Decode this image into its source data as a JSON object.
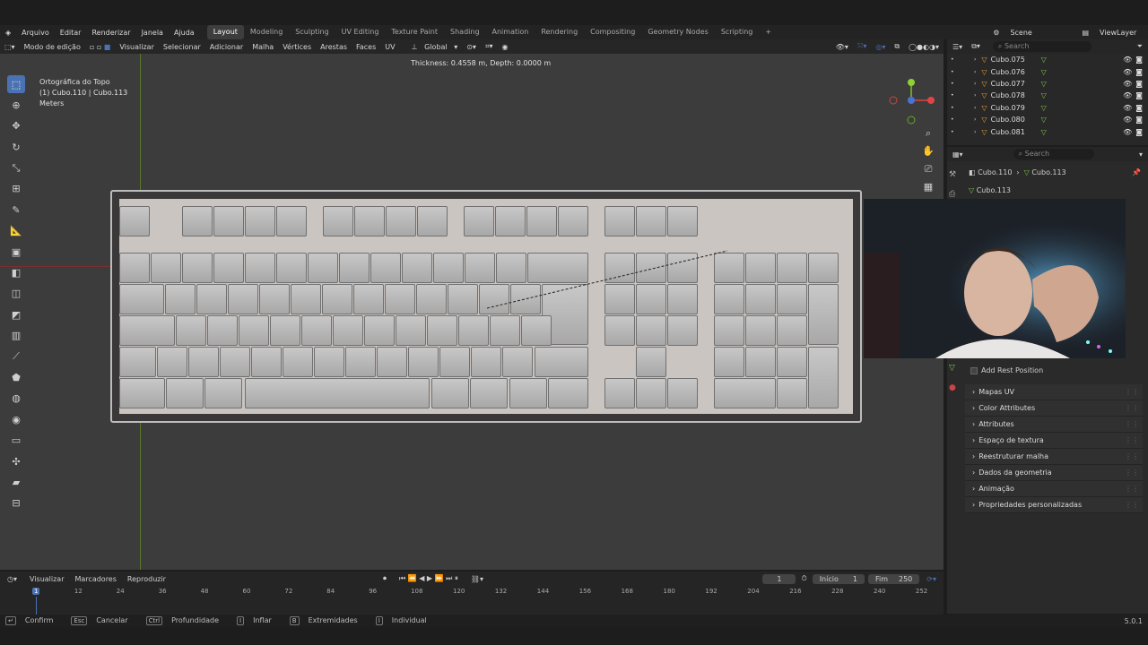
{
  "menu": [
    "Arquivo",
    "Editar",
    "Renderizar",
    "Janela",
    "Ajuda"
  ],
  "workspaces": [
    "Layout",
    "Modeling",
    "Sculpting",
    "UV Editing",
    "Texture Paint",
    "Shading",
    "Animation",
    "Rendering",
    "Compositing",
    "Geometry Nodes",
    "Scripting"
  ],
  "active_workspace": "Layout",
  "scene": "Scene",
  "view_layer": "ViewLayer",
  "header": {
    "mode": "Modo de edição",
    "items": [
      "Visualizar",
      "Selecionar",
      "Adicionar",
      "Malha",
      "Vértices",
      "Arestas",
      "Faces",
      "UV"
    ],
    "orientation": "Global"
  },
  "operator_info": "Thickness: 0.4558 m, Depth: 0.0000 m",
  "viewport_info": [
    "Ortográfica do Topo",
    "(1) Cubo.110 | Cubo.113",
    "Meters"
  ],
  "outliner": {
    "search_placeholder": "Search",
    "items": [
      "Cubo.075",
      "Cubo.076",
      "Cubo.077",
      "Cubo.078",
      "Cubo.079",
      "Cubo.080",
      "Cubo.081"
    ]
  },
  "properties": {
    "search_placeholder": "Search",
    "breadcrumb_object": "Cubo.110",
    "breadcrumb_mesh": "Cubo.113",
    "datablock": "Cubo.113",
    "add_rest_position": "Add Rest Position",
    "panels": [
      "Mapas UV",
      "Color Attributes",
      "Attributes",
      "Espaço de textura",
      "Reestruturar malha",
      "Dados da geometria",
      "Animação",
      "Propriedades personalizadas"
    ]
  },
  "timeline": {
    "menus": [
      "Visualizar",
      "Marcadores",
      "Reproduzir"
    ],
    "current_frame": "1",
    "start_label": "Início",
    "start": "1",
    "end_label": "Fim",
    "end": "250",
    "ticks": [
      "1",
      "12",
      "24",
      "36",
      "48",
      "60",
      "72",
      "84",
      "96",
      "108",
      "120",
      "132",
      "144",
      "156",
      "168",
      "180",
      "192",
      "204",
      "216",
      "228",
      "240",
      "252"
    ]
  },
  "status": {
    "items": [
      {
        "key": "↵",
        "label": "Confirm"
      },
      {
        "key": "Esc",
        "label": "Cancelar"
      },
      {
        "key": "Ctrl",
        "label": "Profundidade"
      },
      {
        "key": "I",
        "label": "Inflar"
      },
      {
        "key": "B",
        "label": "Extremidades"
      },
      {
        "key": "I",
        "label": "Individual"
      }
    ],
    "version": "5.0.1"
  },
  "colors": {
    "accent": "#4a72b3",
    "viewport": "#3c3c3c",
    "keyboard_plate": "#cbc5c1"
  }
}
